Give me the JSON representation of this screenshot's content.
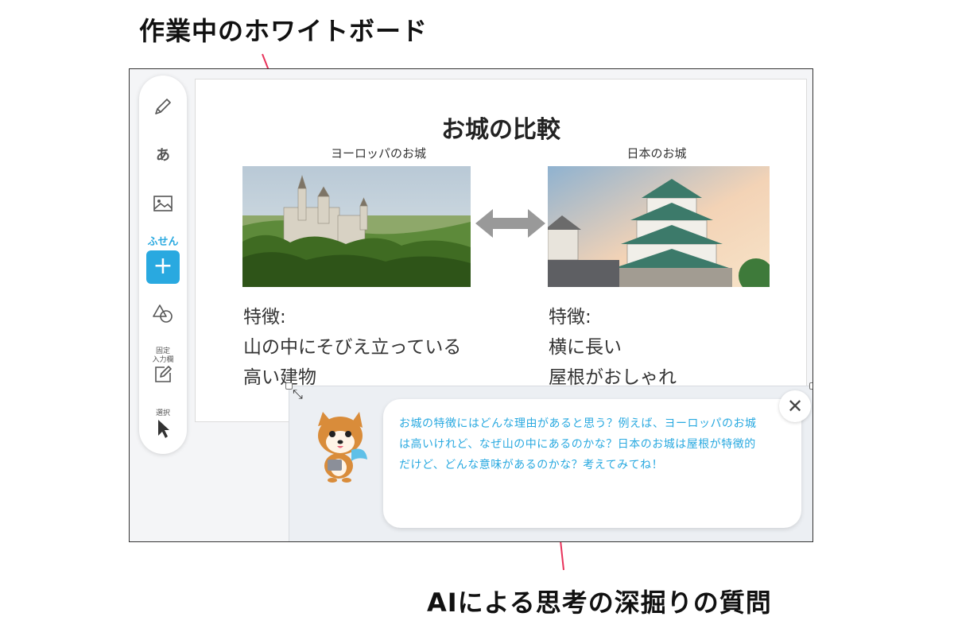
{
  "annotations": {
    "top_label": "作業中のホワイトボード",
    "bottom_label": "AIによる思考の深掘りの質問",
    "accent_color": "#e8325a"
  },
  "toolbar": {
    "items": [
      {
        "icon": "pencil-icon",
        "label": ""
      },
      {
        "icon": "hiragana-text-icon",
        "label": "あ"
      },
      {
        "icon": "image-icon",
        "label": ""
      },
      {
        "icon": "plus-icon",
        "label": "ふせん"
      },
      {
        "icon": "shapes-icon",
        "label": ""
      },
      {
        "icon": "edit-box-icon",
        "label": "固定\n入力欄"
      },
      {
        "icon": "cursor-icon",
        "label": "選択"
      }
    ],
    "accent_color": "#29a9e0"
  },
  "board": {
    "title": "お城の比較",
    "europe": {
      "caption": "ヨーロッパのお城",
      "photo": "castle-photo",
      "feature_heading": "特徴:",
      "feature_lines": [
        "山の中にそびえ立っている",
        "高い建物"
      ]
    },
    "japan": {
      "caption": "日本のお城",
      "photo": "japanese-castle-photo",
      "feature_heading": "特徴:",
      "feature_lines": [
        "横に長い",
        "屋根がおしゃれ"
      ]
    },
    "compare_icon": "double-arrow-icon"
  },
  "ai_panel": {
    "message": "お城の特徴にはどんな理由があると思う？例えば、ヨーロッパのお城は高いけれど、なぜ山の中にあるのかな？日本のお城は屋根が特徴的だけど、どんな意味があるのかな？考えてみてね！",
    "close_label": "✕",
    "mascot": "shiba-dog-mascot",
    "resize_label": "⤡",
    "text_color": "#29a9e0"
  }
}
